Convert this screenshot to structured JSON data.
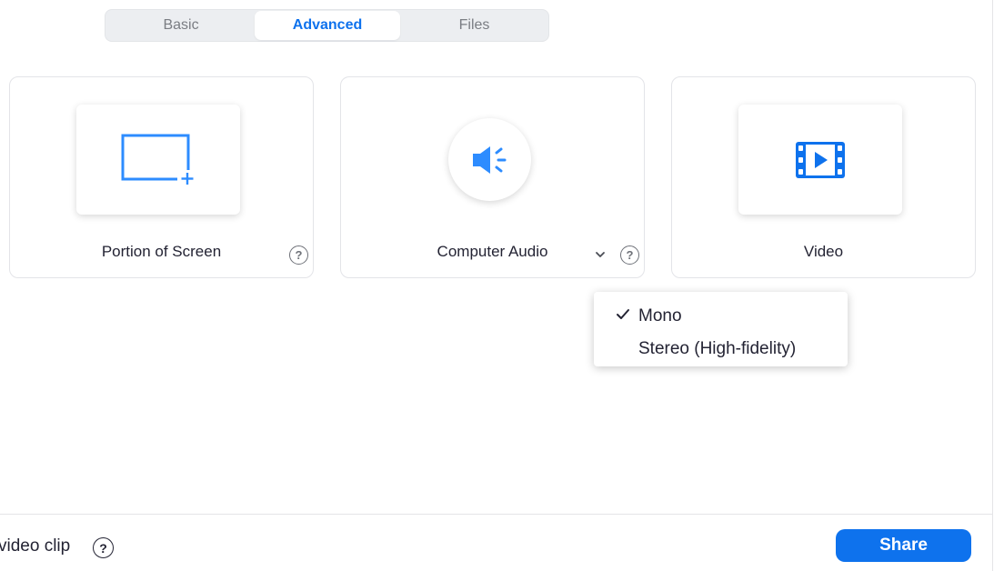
{
  "tabs": [
    {
      "label": "Basic",
      "active": false
    },
    {
      "label": "Advanced",
      "active": true
    },
    {
      "label": "Files",
      "active": false
    }
  ],
  "cards": [
    {
      "label": "Portion of Screen",
      "icon": "screen-portion-icon"
    },
    {
      "label": "Computer Audio",
      "icon": "speaker-icon"
    },
    {
      "label": "Video",
      "icon": "video-film-icon"
    }
  ],
  "help_glyph": "?",
  "dropdown": {
    "options": [
      {
        "label": "Mono",
        "checked": true
      },
      {
        "label": "Stereo (High-fidelity)",
        "checked": false
      }
    ]
  },
  "footer": {
    "option_text": "video clip",
    "share_label": "Share"
  },
  "colors": {
    "accent": "#0e72ed",
    "icon_blue": "#2d8cff",
    "text": "#232333",
    "muted": "#7a7d83"
  }
}
